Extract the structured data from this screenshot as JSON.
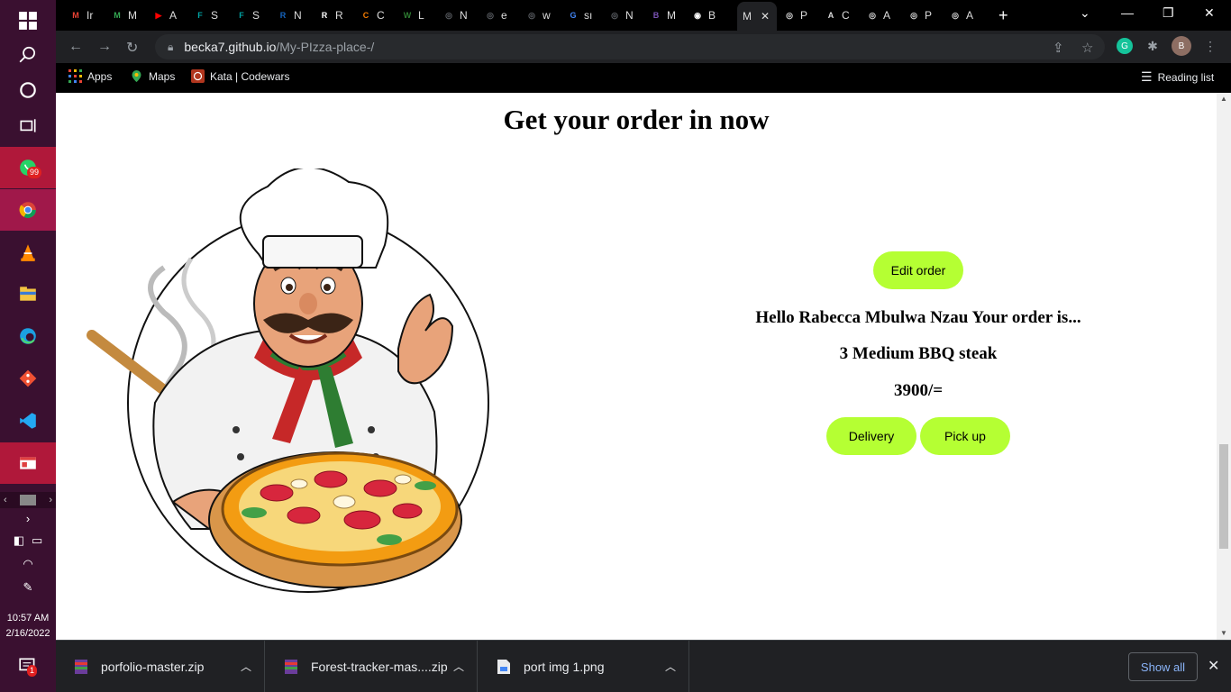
{
  "browser": {
    "url_host": "becka7.github.io",
    "url_path": "/My-PIzza-place-/",
    "tabs": [
      {
        "fav": "M",
        "label": "Ir",
        "color": "#ea4335"
      },
      {
        "fav": "M",
        "label": "M",
        "color": "#34a853"
      },
      {
        "fav": "▶",
        "label": "A",
        "color": "#ff0000"
      },
      {
        "fav": "F",
        "label": "S",
        "color": "#00a3a3"
      },
      {
        "fav": "F",
        "label": "S",
        "color": "#00a3a3"
      },
      {
        "fav": "R",
        "label": "N",
        "color": "#1565c0"
      },
      {
        "fav": "R",
        "label": "R",
        "color": "#ffffff"
      },
      {
        "fav": "C",
        "label": "C",
        "color": "#f57c00"
      },
      {
        "fav": "W",
        "label": "L",
        "color": "#2e7d32"
      },
      {
        "fav": "◎",
        "label": "N",
        "color": "#5f6368"
      },
      {
        "fav": "◎",
        "label": "e",
        "color": "#5f6368"
      },
      {
        "fav": "◎",
        "label": "w",
        "color": "#5f6368"
      },
      {
        "fav": "G",
        "label": "sı",
        "color": "#4285f4"
      },
      {
        "fav": "◎",
        "label": "N",
        "color": "#5f6368"
      },
      {
        "fav": "B",
        "label": "M",
        "color": "#7952b3"
      },
      {
        "fav": "◉",
        "label": "B",
        "color": "#ffffff"
      }
    ],
    "active_tab_label": "M",
    "tabs_after": [
      {
        "fav": "◎",
        "label": "P"
      },
      {
        "fav": "A",
        "label": "C"
      },
      {
        "fav": "◎",
        "label": "A"
      },
      {
        "fav": "◎",
        "label": "P"
      },
      {
        "fav": "◎",
        "label": "A"
      }
    ],
    "bookmarks": [
      "Apps",
      "Maps",
      "Kata | Codewars"
    ],
    "reading_list": "Reading list",
    "profile_initial": "B"
  },
  "taskbar": {
    "whatsapp_badge": "99",
    "notify_badge": "1",
    "time": "10:57 AM",
    "date": "2/16/2022"
  },
  "page": {
    "title": "Get your order in now",
    "edit_order": "Edit order",
    "greeting": "Hello Rabecca Mbulwa Nzau Your order is...",
    "order_item": "3 Medium BBQ steak",
    "price": "3900/=",
    "delivery": "Delivery",
    "pickup": "Pick up"
  },
  "downloads": [
    {
      "name": "porfolio-master.zip"
    },
    {
      "name": "Forest-tracker-mas....zip"
    },
    {
      "name": "port img 1.png"
    }
  ],
  "downloads_show_all": "Show all",
  "colors": {
    "accent_lime": "#b5ff33",
    "chrome_bg": "#202124",
    "taskbar_bg": "#3a1030"
  }
}
